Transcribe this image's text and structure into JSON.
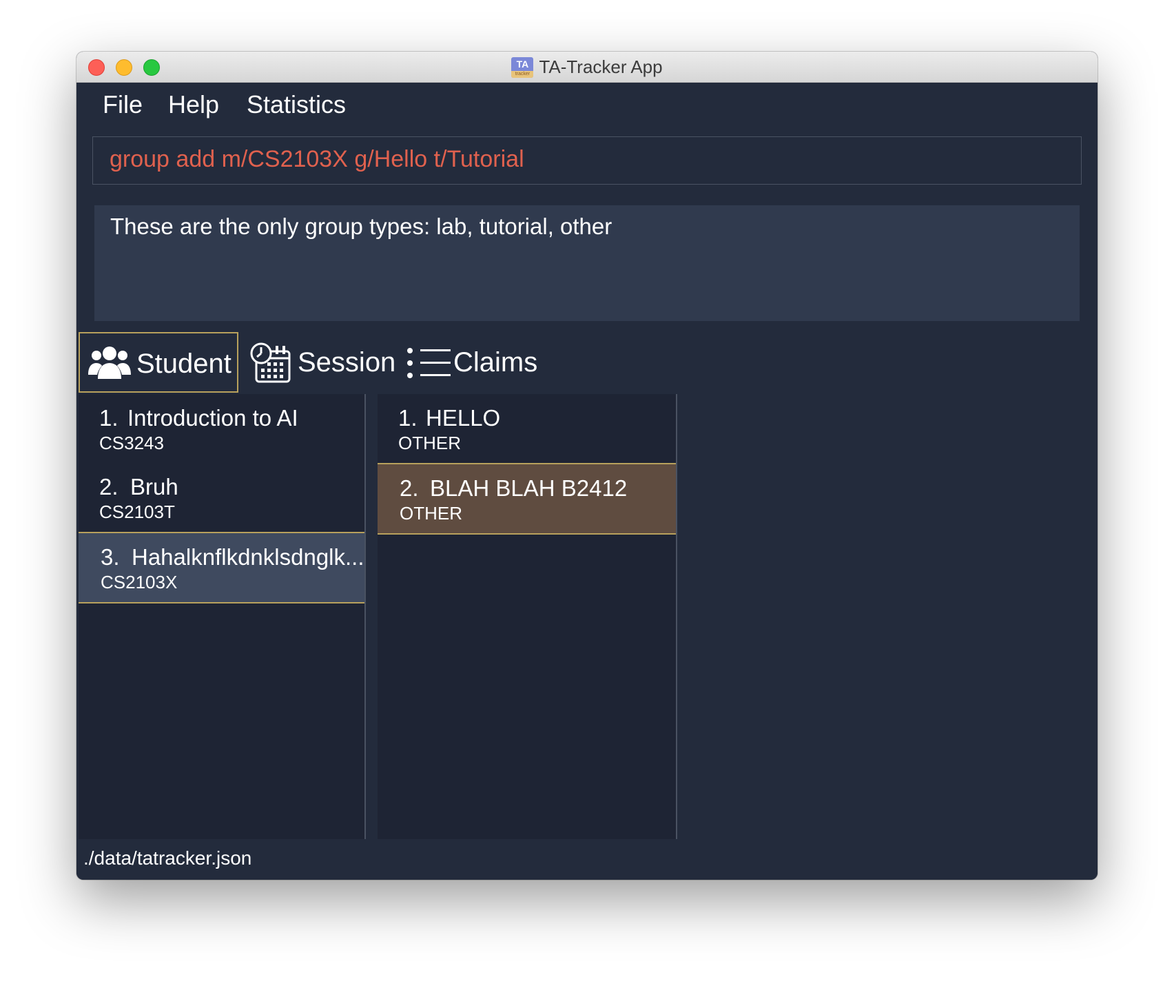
{
  "window": {
    "title": "TA-Tracker App",
    "app_icon_text": "TA",
    "app_icon_subtext": "tracker"
  },
  "menu": {
    "items": [
      "File",
      "Help",
      "Statistics"
    ]
  },
  "command_box": {
    "value": "group add m/CS2103X g/Hello t/Tutorial"
  },
  "result_display": {
    "text": "These are the only group types: lab, tutorial, other"
  },
  "tabs": [
    {
      "label": "Student",
      "icon": "users-icon",
      "selected": true
    },
    {
      "label": "Session",
      "icon": "calendar-clock-icon",
      "selected": false
    },
    {
      "label": "Claims",
      "icon": "list-icon",
      "selected": false
    }
  ],
  "modules": [
    {
      "index": "1.",
      "name": "Introduction to AI",
      "code": "CS3243"
    },
    {
      "index": "2.",
      "name": "Bruh",
      "code": "CS2103T"
    },
    {
      "index": "3.",
      "name": "Hahalknflkdnklsdnglk...",
      "code": "CS2103X",
      "selected": true
    }
  ],
  "groups": [
    {
      "index": "1.",
      "name": "HELLO",
      "type": "OTHER"
    },
    {
      "index": "2.",
      "name": "BLAH BLAH B2412",
      "type": "OTHER",
      "selected": true
    }
  ],
  "status_bar": {
    "file_path": "./data/tatracker.json"
  },
  "colors": {
    "background": "#232b3c",
    "command_text": "#e0614e",
    "selection_border": "#b8a15c",
    "selected_module": "#3f4a5f",
    "selected_group": "#5f4c40"
  }
}
